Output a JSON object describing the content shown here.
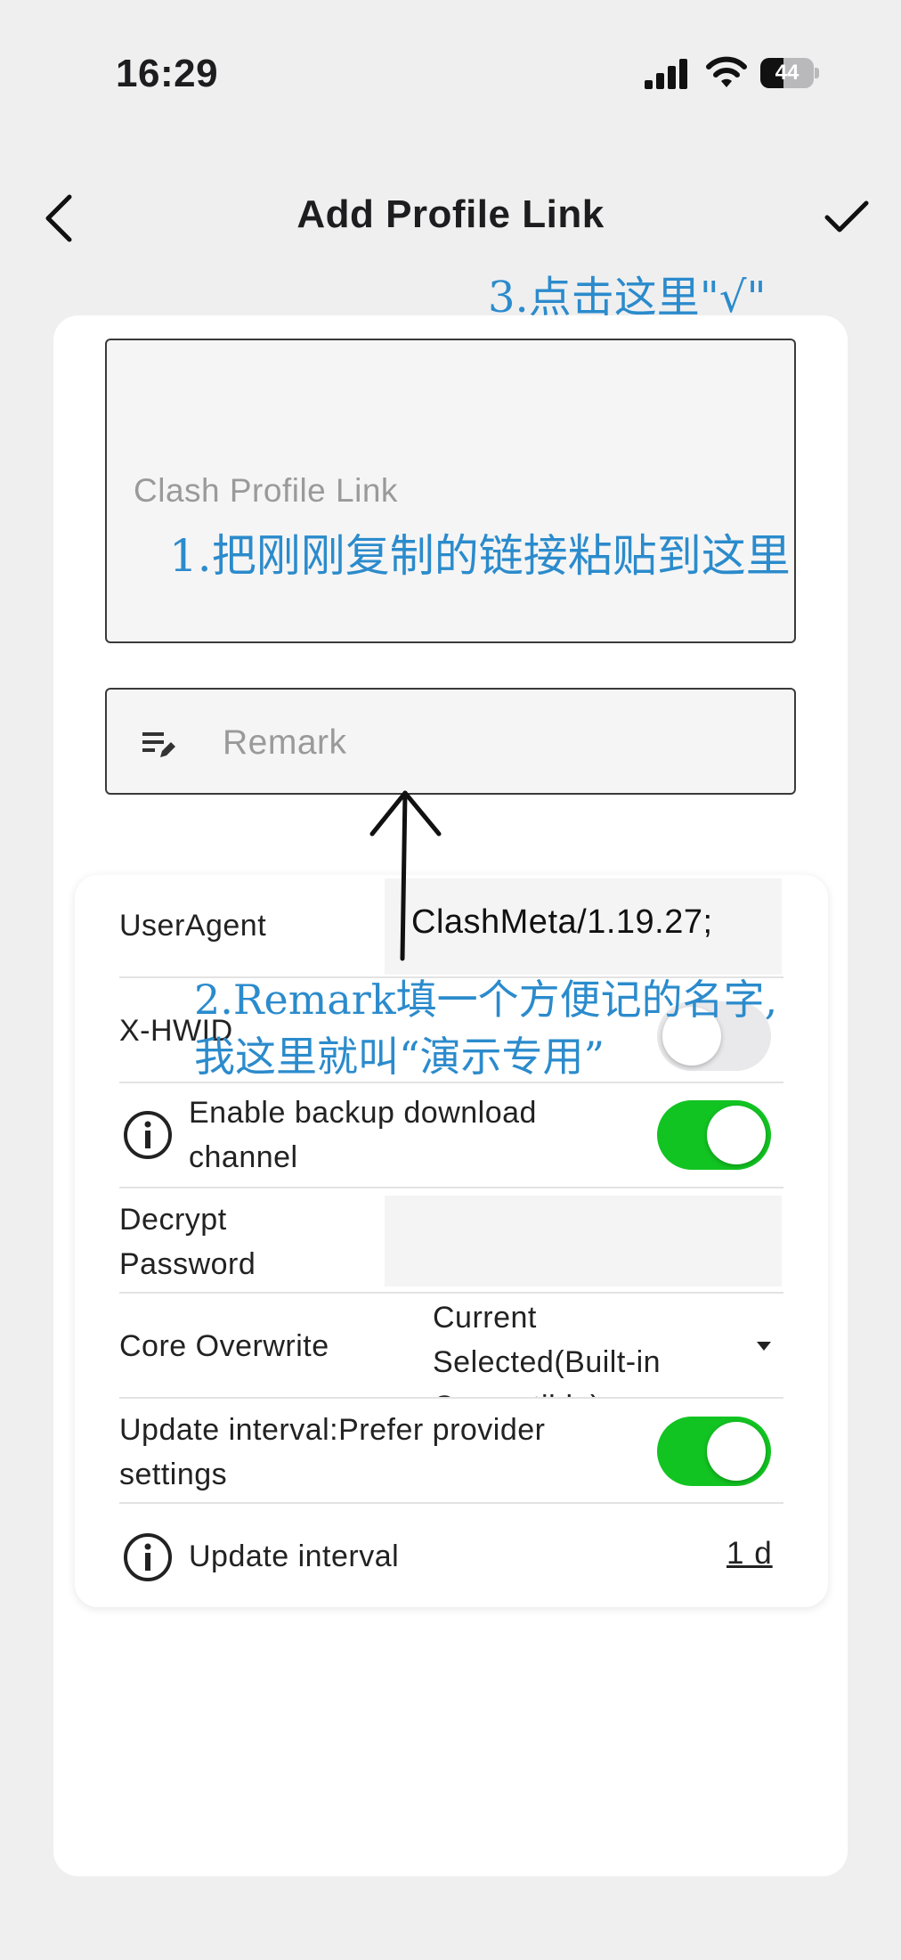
{
  "status_bar": {
    "time": "16:29",
    "battery": "44",
    "battery_level": 0.44
  },
  "header": {
    "title": "Add Profile Link"
  },
  "annotations": {
    "confirm_hint": "3.点击这里\"√\"",
    "link_hint": "1.把刚刚复制的链接粘贴到这里",
    "remark_hint_line1": "2.Remark填一个方便记的名字,",
    "remark_hint_line2": "我这里就叫“演示专用”"
  },
  "form": {
    "link_placeholder": "Clash Profile Link",
    "remark_placeholder": "Remark"
  },
  "settings": {
    "user_agent": {
      "label": "UserAgent",
      "value": "ClashMeta/1.19.27;"
    },
    "hwid": {
      "label": "X-HWID",
      "enabled": false
    },
    "backup_channel": {
      "label_line1": "Enable backup download",
      "label_line2": "channel",
      "enabled": true
    },
    "decrypt_password": {
      "label_line1": "Decrypt",
      "label_line2": "Password",
      "value": ""
    },
    "core_overwrite": {
      "label": "Core Overwrite",
      "value_line1": "Current",
      "value_line2": "Selected(Built-in",
      "value_line3": "Compatible)"
    },
    "prefer_provider": {
      "label_line1": "Update interval:Prefer provider",
      "label_line2": "settings",
      "enabled": true
    },
    "update_interval": {
      "label": "Update interval",
      "value": "1 d"
    }
  },
  "colors": {
    "toggle_on": "#12c422",
    "annotation": "#2b8bcc",
    "background": "#efeff0"
  }
}
